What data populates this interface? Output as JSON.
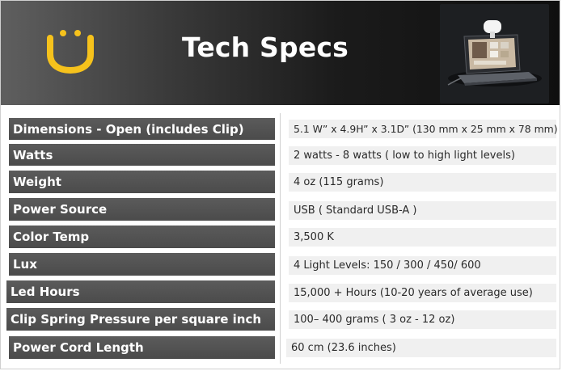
{
  "header": {
    "title": "Tech Specs",
    "logo_icon": "smiley-face-logo-icon",
    "brand_color": "#F6C21C",
    "product_image": "laptop-with-clip-light-image"
  },
  "specs": [
    {
      "label": "Dimensions - Open (includes Clip)",
      "value": "5.1 W”  x 4.9H” x 3.1D”  (130 mm x 25 mm x 78 mm)"
    },
    {
      "label": "Watts",
      "value": " 2 watts - 8 watts ( low to high light levels)"
    },
    {
      "label": "Weight",
      "value": "4 oz (115 grams)"
    },
    {
      "label": "Power Source",
      "value": "USB  ( Standard USB-A )"
    },
    {
      "label": "Color Temp",
      "value": "3,500 K"
    },
    {
      "label": "Lux",
      "value": "4 Light Levels:  150 / 300 / 450/ 600"
    },
    {
      "label": "Led Hours",
      "value": "15,000 + Hours (10-20 years of average use)"
    },
    {
      "label": "Clip Spring Pressure per square inch",
      "value": "100– 400 grams ( 3 oz  - 12 oz)"
    },
    {
      "label": "Power Cord Length",
      "value": "60 cm (23.6 inches)"
    }
  ]
}
